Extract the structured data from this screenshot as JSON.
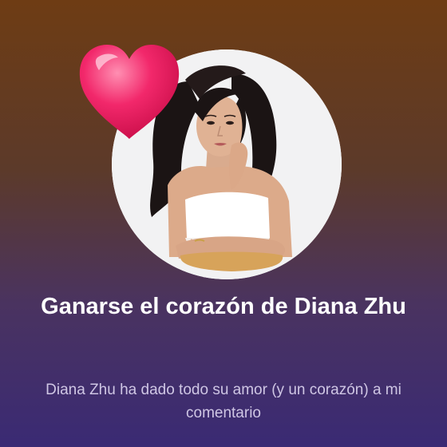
{
  "achievement": {
    "title": "Ganarse el corazón de Diana Zhu",
    "description": "Diana Zhu ha dado todo su amor (y un corazón) a mi comentario",
    "badge_icon": "heart-icon",
    "avatar": "profile-photo",
    "colors": {
      "background_top": "#6e3c14",
      "background_bottom": "#3a2a74",
      "heart": "#f01f66",
      "title": "#ffffff",
      "description": "#cfc6e4"
    }
  }
}
